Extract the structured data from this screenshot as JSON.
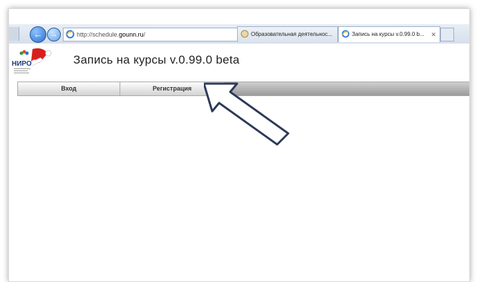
{
  "browser": {
    "url_prefix": "http://schedule.",
    "url_domain": "gounn.ru",
    "url_suffix": "/",
    "address_tools": "⌕ ▾ ↻ ✕",
    "tabs": [
      {
        "label": "Образовательная деятельнос..."
      },
      {
        "label": "Запись на курсы v.0.99.0 b...",
        "close": "✕"
      }
    ]
  },
  "header": {
    "logo_text": "НИРО",
    "title": "Запись на курсы v.0.99.0 beta"
  },
  "menu": {
    "login_label": "Вход",
    "register_label": "Регистрация"
  },
  "colors": {
    "arrow_stroke": "#2b3a58",
    "arrow_fill": "#ffffff",
    "menu_rest": "#a4a4a4"
  }
}
